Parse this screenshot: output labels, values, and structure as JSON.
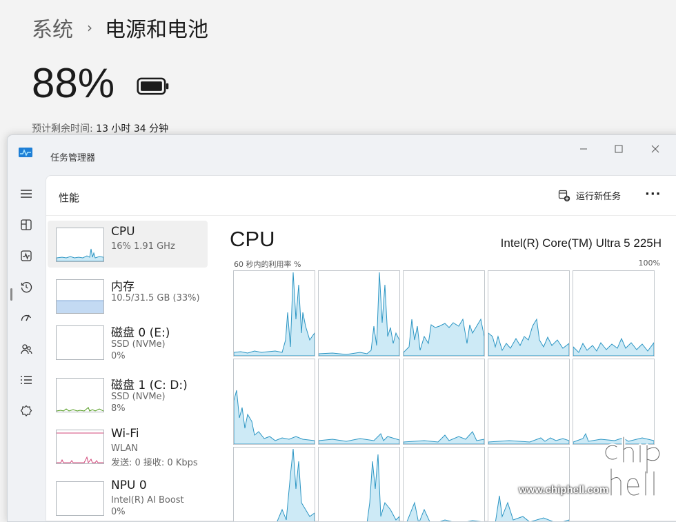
{
  "settings": {
    "breadcrumb_parent": "系统",
    "breadcrumb_sep": "›",
    "breadcrumb_current": "电源和电池",
    "battery_percent": "88%",
    "remaining_label": "预计剩余时间:",
    "remaining_value": "13 小时 34 分钟"
  },
  "taskmanager": {
    "title": "任务管理器",
    "page_title": "性能",
    "run_new_task": "运行新任务",
    "more": "···",
    "nav_icons": [
      "hamburger-icon",
      "processes-icon",
      "performance-icon",
      "history-icon",
      "startup-icon",
      "users-icon",
      "details-icon",
      "services-icon"
    ],
    "resources": [
      {
        "name": "CPU",
        "line1": "16% 1.91 GHz",
        "line2": ""
      },
      {
        "name": "内存",
        "line1": "10.5/31.5 GB (33%)",
        "line2": ""
      },
      {
        "name": "磁盘 0 (E:)",
        "line1": "SSD (NVMe)",
        "line2": "0%"
      },
      {
        "name": "磁盘 1 (C: D:)",
        "line1": "SSD (NVMe)",
        "line2": "8%"
      },
      {
        "name": "Wi-Fi",
        "line1": "WLAN",
        "line2": "发送: 0 接收: 0 Kbps"
      },
      {
        "name": "NPU 0",
        "line1": "Intel(R) AI Boost",
        "line2": "0%"
      }
    ],
    "detail": {
      "title": "CPU",
      "model": "Intel(R) Core(TM) Ultra 5 225H",
      "axis_label": "60 秒内的利用率 %",
      "axis_max": "100%"
    }
  },
  "colors": {
    "cpu_line": "#2b95c3",
    "cpu_fill": "#cdeaf6",
    "memory_fill": "#c3daf3",
    "disk1_line": "#4f9a1a",
    "wifi_line": "#d04477"
  },
  "watermark": {
    "url": "www.chiphell.com",
    "logo": "chip hell"
  }
}
